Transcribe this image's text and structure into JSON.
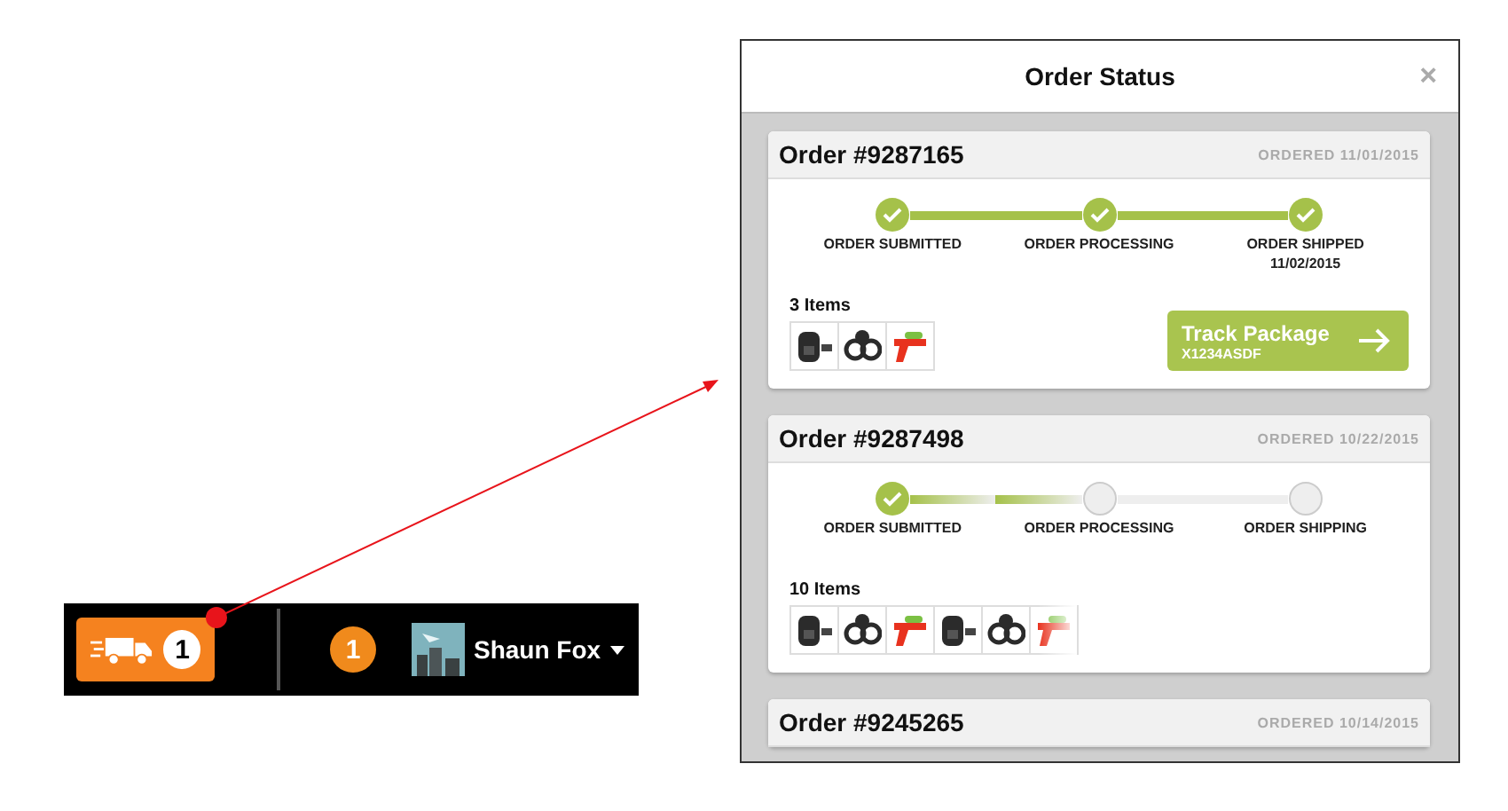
{
  "navbar": {
    "delivery_count": "1",
    "notification_count": "1",
    "user_name": "Shaun Fox"
  },
  "modal": {
    "title": "Order Status",
    "close": "×",
    "orders": [
      {
        "number": "Order #9287165",
        "ordered": "ORDERED 11/01/2015",
        "steps": [
          {
            "label": "ORDER SUBMITTED",
            "done": true
          },
          {
            "label": "ORDER PROCESSING",
            "done": true
          },
          {
            "label": "ORDER SHIPPED",
            "date": "11/02/2015",
            "done": true
          }
        ],
        "items_label": "3 Items",
        "items": [
          {
            "kind": "backpack"
          },
          {
            "kind": "tripod"
          },
          {
            "kind": "water-gun"
          }
        ],
        "overflow": false,
        "track": {
          "label": "Track Package",
          "code": "X1234ASDF"
        }
      },
      {
        "number": "Order #9287498",
        "ordered": "ORDERED 10/22/2015",
        "steps": [
          {
            "label": "ORDER SUBMITTED",
            "done": true
          },
          {
            "label": "ORDER PROCESSING",
            "done": false
          },
          {
            "label": "ORDER SHIPPING",
            "done": false
          }
        ],
        "items_label": "10 Items",
        "items": [
          {
            "kind": "backpack"
          },
          {
            "kind": "tripod"
          },
          {
            "kind": "water-gun"
          },
          {
            "kind": "backpack"
          },
          {
            "kind": "tripod"
          },
          {
            "kind": "water-gun"
          }
        ],
        "overflow": true
      },
      {
        "number": "Order #9245265",
        "ordered": "ORDERED 10/14/2015"
      }
    ]
  }
}
